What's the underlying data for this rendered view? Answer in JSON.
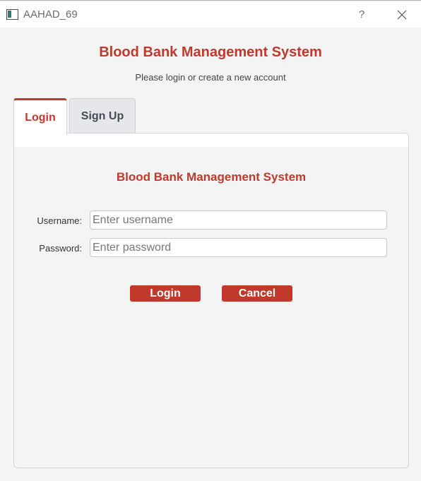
{
  "window": {
    "title": "AAHAD_69",
    "help_label": "?"
  },
  "header": {
    "title": "Blood Bank Management System",
    "subtitle": "Please login or create a new account"
  },
  "tabs": [
    {
      "label": "Login",
      "active": true
    },
    {
      "label": "Sign Up",
      "active": false
    }
  ],
  "login_form": {
    "title": "Blood Bank Management System",
    "username_label": "Username:",
    "username_placeholder": "Enter username",
    "username_value": "",
    "password_label": "Password:",
    "password_placeholder": "Enter password",
    "password_value": "",
    "login_button": "Login",
    "cancel_button": "Cancel"
  },
  "colors": {
    "accent": "#c0392b",
    "background": "#f4f4f5",
    "inactive_tab": "#e6e7ea"
  }
}
